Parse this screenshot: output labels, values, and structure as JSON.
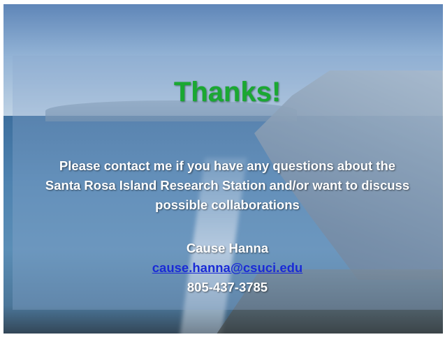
{
  "slide": {
    "title": "Thanks!",
    "message_lines": [
      "Please contact me if you have any questions about the",
      "Santa Rosa Island Research Station and/or want to discuss",
      "possible collaborations"
    ],
    "contact": {
      "name": "Cause Hanna",
      "email": "cause.hanna@csuci.edu",
      "phone": "805-437-3785"
    }
  },
  "colors": {
    "title": "#1aa832",
    "text": "#ffffff",
    "link": "#1a2bd6"
  }
}
